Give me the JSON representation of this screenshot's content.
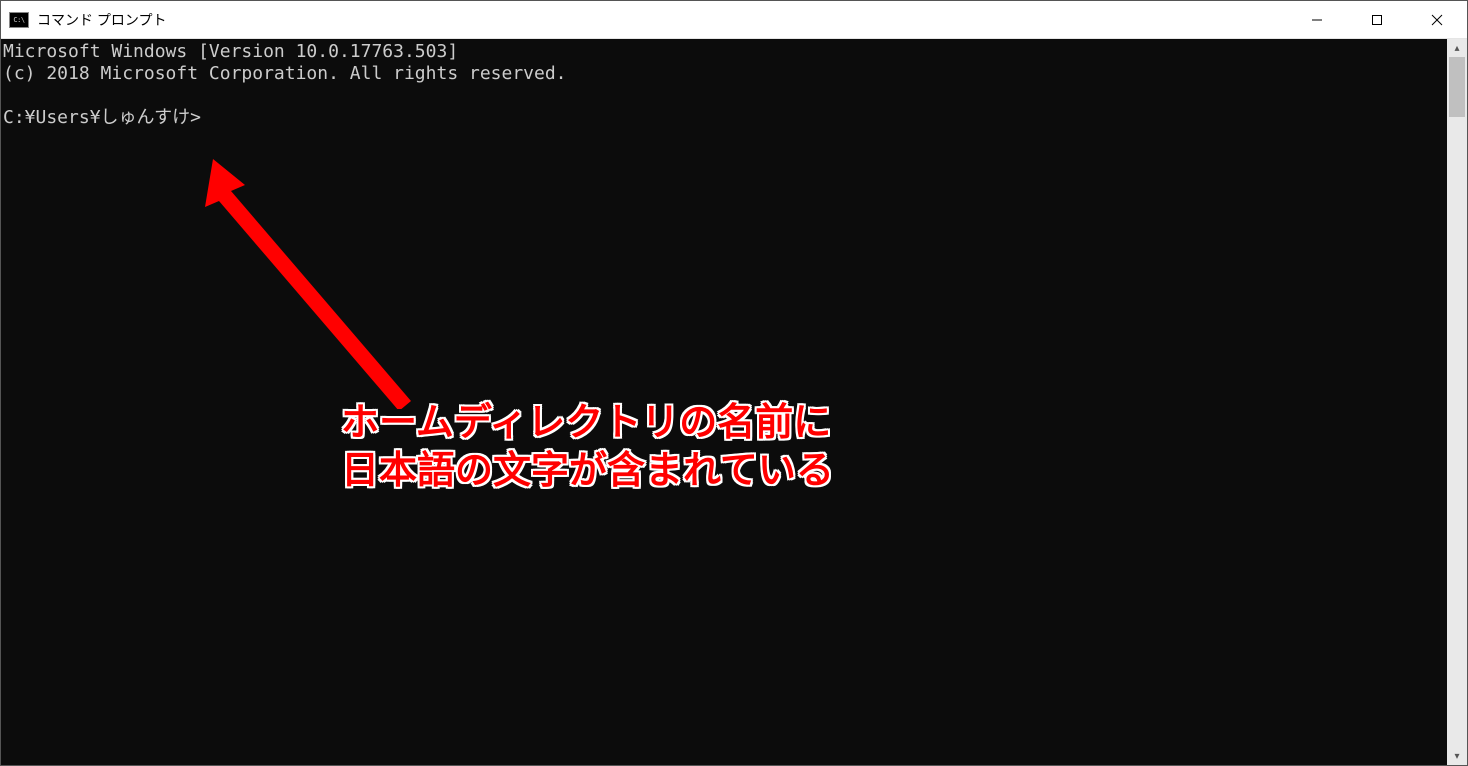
{
  "titlebar": {
    "title": "コマンド プロンプト"
  },
  "console": {
    "line1": "Microsoft Windows [Version 10.0.17763.503]",
    "line2": "(c) 2018 Microsoft Corporation. All rights reserved.",
    "blank": "",
    "prompt": "C:¥Users¥しゅんすけ>"
  },
  "annotation": {
    "line1": "ホームディレクトリの名前に",
    "line2": "日本語の文字が含まれている"
  }
}
